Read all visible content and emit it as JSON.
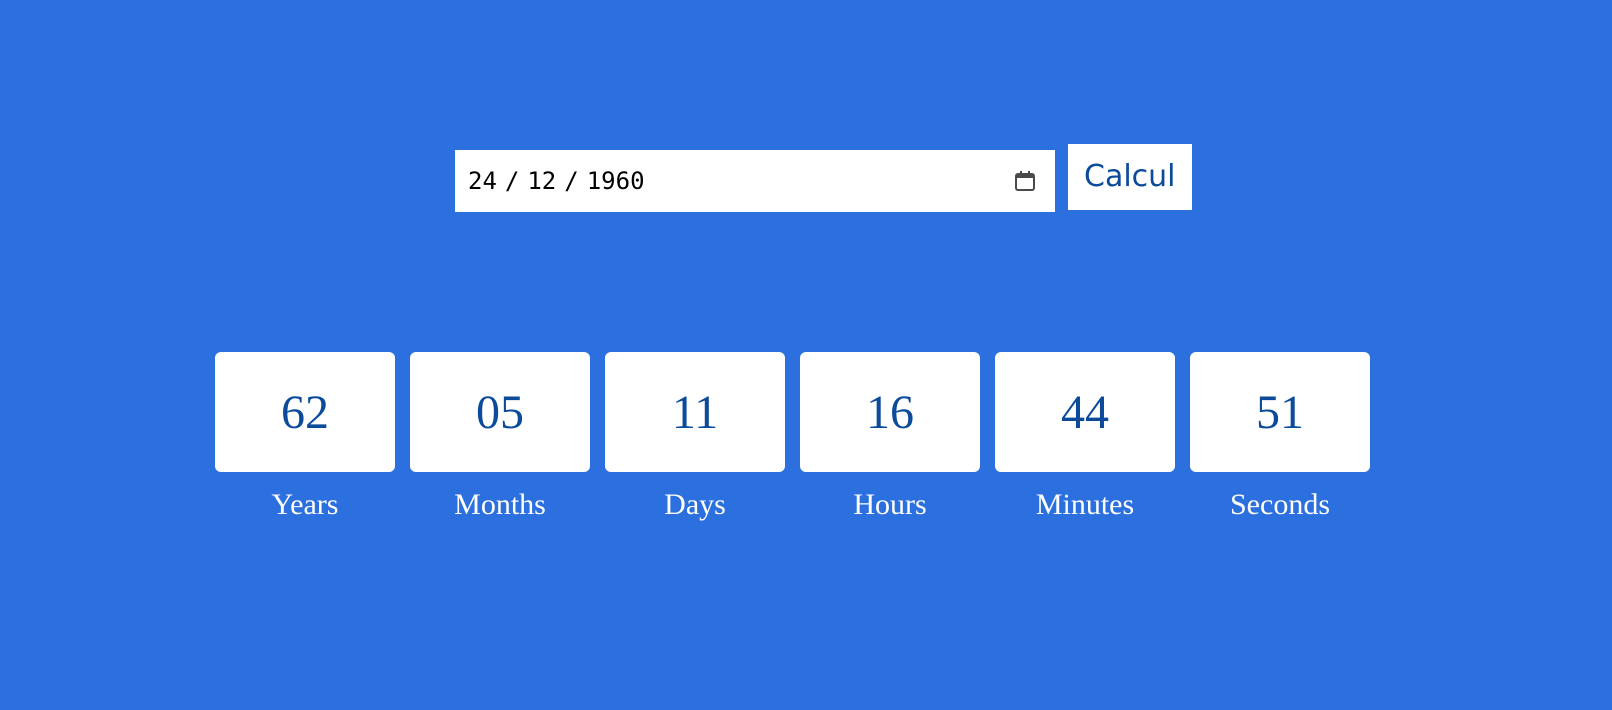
{
  "colors": {
    "background": "#2c70e0",
    "card": "#ffffff",
    "accent": "#0b4b9a",
    "label": "#ffffff"
  },
  "date_input": {
    "day": "24",
    "month": "12",
    "year": "1960",
    "separator": "/",
    "icon": "calendar-icon"
  },
  "calculate_button": {
    "label": "Calcul"
  },
  "counters": [
    {
      "value": "62",
      "label": "Years"
    },
    {
      "value": "05",
      "label": "Months"
    },
    {
      "value": "11",
      "label": "Days"
    },
    {
      "value": "16",
      "label": "Hours"
    },
    {
      "value": "44",
      "label": "Minutes"
    },
    {
      "value": "51",
      "label": "Seconds"
    }
  ]
}
